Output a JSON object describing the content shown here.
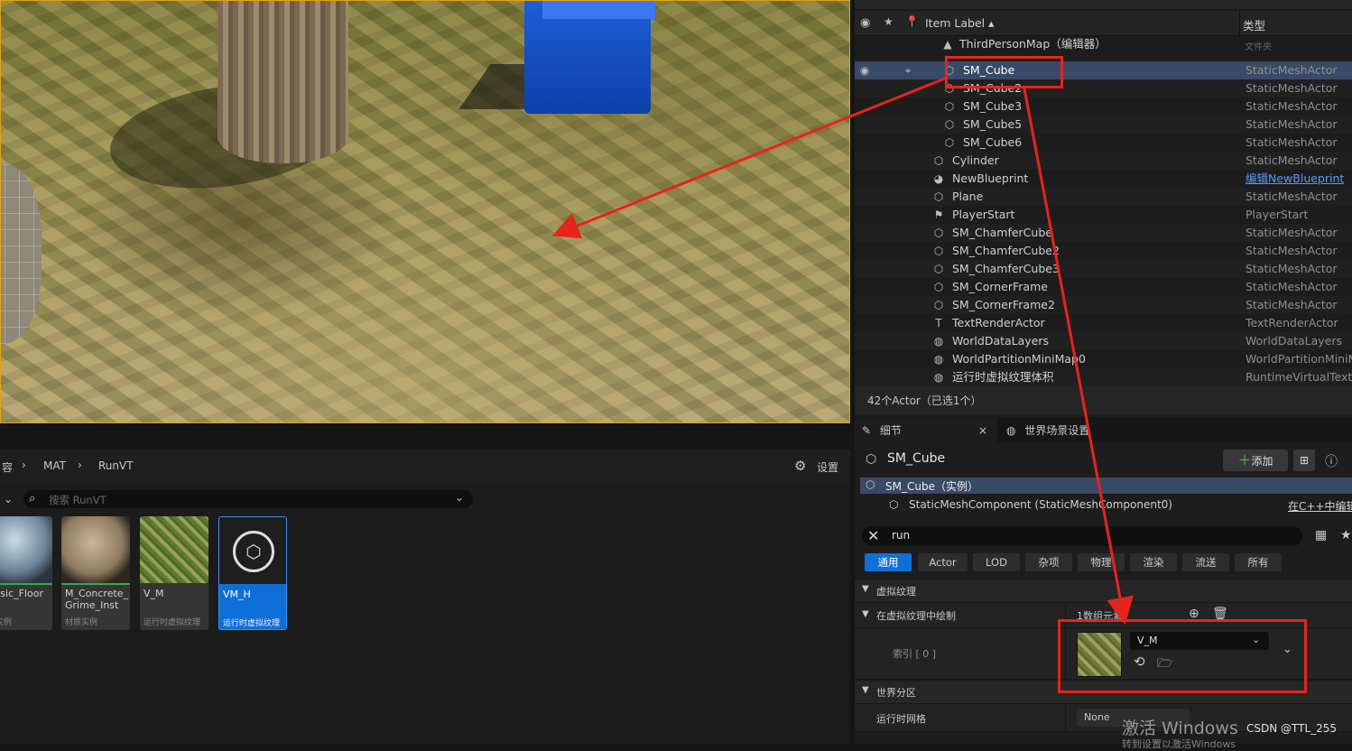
{
  "viewport": {},
  "outliner": {
    "header": {
      "item_label": "Item Label ▴",
      "type": "类型"
    },
    "map_title": "ThirdPersonMap（编辑器）",
    "partial_text": "文件夹",
    "items": [
      {
        "label": "SM_Cube",
        "type": "StaticMeshActor",
        "icon": "cube-icon",
        "selected": true
      },
      {
        "label": "SM_Cube2",
        "type": "StaticMeshActor",
        "icon": "cube-icon"
      },
      {
        "label": "SM_Cube3",
        "type": "StaticMeshActor",
        "icon": "cube-icon"
      },
      {
        "label": "SM_Cube5",
        "type": "StaticMeshActor",
        "icon": "cube-icon"
      },
      {
        "label": "SM_Cube6",
        "type": "StaticMeshActor",
        "icon": "cube-icon"
      },
      {
        "label": "Cylinder",
        "type": "StaticMeshActor",
        "icon": "cube-icon"
      },
      {
        "label": "NewBlueprint",
        "type": "编辑NewBlueprint",
        "icon": "blueprint-icon",
        "type_link": true
      },
      {
        "label": "Plane",
        "type": "StaticMeshActor",
        "icon": "cube-icon"
      },
      {
        "label": "PlayerStart",
        "type": "PlayerStart",
        "icon": "flag-icon"
      },
      {
        "label": "SM_ChamferCube",
        "type": "StaticMeshActor",
        "icon": "cube-icon"
      },
      {
        "label": "SM_ChamferCube2",
        "type": "StaticMeshActor",
        "icon": "cube-icon"
      },
      {
        "label": "SM_ChamferCube3",
        "type": "StaticMeshActor",
        "icon": "cube-icon"
      },
      {
        "label": "SM_CornerFrame",
        "type": "StaticMeshActor",
        "icon": "cube-icon"
      },
      {
        "label": "SM_CornerFrame2",
        "type": "StaticMeshActor",
        "icon": "cube-icon"
      },
      {
        "label": "TextRenderActor",
        "type": "TextRenderActor",
        "icon": "text-icon"
      },
      {
        "label": "WorldDataLayers",
        "type": "WorldDataLayers",
        "icon": "globe-icon"
      },
      {
        "label": "WorldPartitionMiniMap0",
        "type": "WorldPartitionMiniMa",
        "icon": "globe-icon"
      },
      {
        "label": "运行时虚拟纹理体积",
        "type": "RuntimeVirtualTextu",
        "icon": "globe-icon"
      }
    ],
    "footer": "42个Actor（已选1个）"
  },
  "details": {
    "tab_details": "细节",
    "tab_close": "×",
    "tab_world": "世界场景设置",
    "actor_name": "SM_Cube",
    "add_button": "添加",
    "instance_label": "SM_Cube（实例）",
    "component_label": "StaticMeshComponent (StaticMeshComponent0)",
    "edit_cpp": "在C++中编辑",
    "search_value": "run",
    "categories": [
      "通用",
      "Actor",
      "LOD",
      "杂项",
      "物理",
      "渲染",
      "流送",
      "所有"
    ],
    "section_vt": "虚拟纹理",
    "draw_in_vt": "在虚拟纹理中绘制",
    "array_count": "1数组元素",
    "index_label": "索引 [ 0 ]",
    "asset_name": "V_M",
    "section_world_partition": "世界分区",
    "runtime_grid": "运行时网格",
    "runtime_grid_value": "None"
  },
  "content_browser": {
    "breadcrumb": [
      "容",
      "MAT",
      "RunVT"
    ],
    "settings": "设置",
    "search_placeholder": "搜索 RunVT",
    "assets": [
      {
        "name": "Basic_Floor\nst",
        "type": "质实例"
      },
      {
        "name": "M_Concrete_\nGrime_Inst",
        "type": "材质实例"
      },
      {
        "name": "V_M",
        "type": "运行时虚拟纹理"
      },
      {
        "name": "VM_H",
        "type": "运行时虚拟纹理",
        "selected": true
      }
    ]
  },
  "watermark": {
    "activate": "激活 Windows",
    "csdn": "CSDN @TTL_255",
    "sub": "转到设置以激活Windows"
  },
  "colors": {
    "selection": "#3a4a66",
    "accent_blue": "#0f6fd9",
    "annotation_red": "#e5241c",
    "viewport_border": "#e3a21a"
  }
}
